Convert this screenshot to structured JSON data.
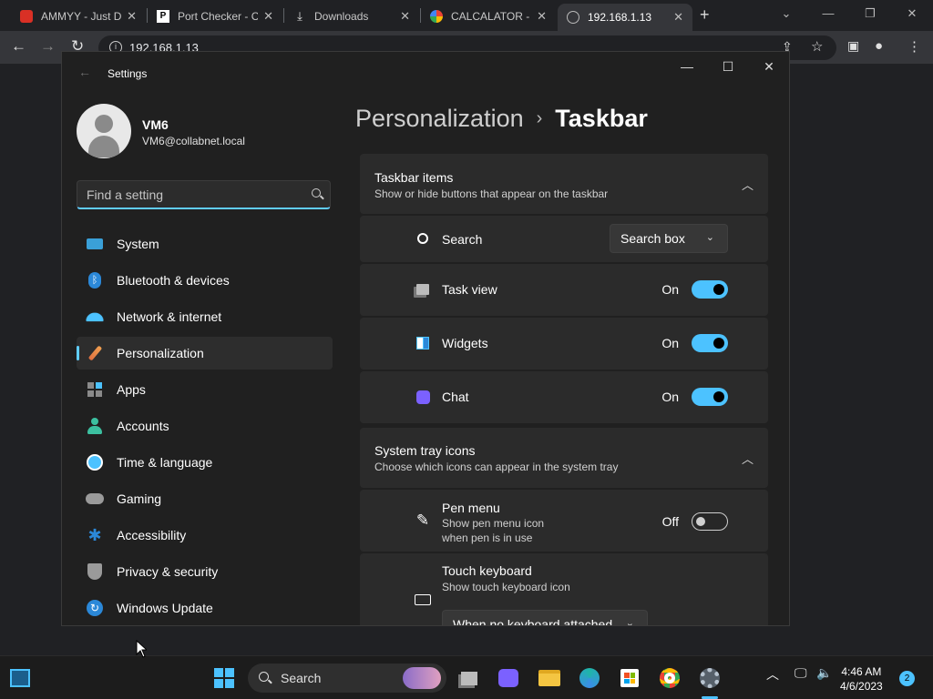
{
  "browser": {
    "tabs": [
      {
        "title": "AMMYY - Just D",
        "icon": "ammyy-icon",
        "color": "#d93025"
      },
      {
        "title": "Port Checker - C",
        "icon": "portchecker-icon",
        "color": "#ffffff"
      },
      {
        "title": "Downloads",
        "icon": "download-icon",
        "color": "#e0e0e0"
      },
      {
        "title": "CALCALATOR - ",
        "icon": "google-icon",
        "color": "#4285f4"
      },
      {
        "title": "192.168.1.13",
        "icon": "globe-icon",
        "color": "#9aa0a6"
      }
    ],
    "url": "192.168.1.13"
  },
  "settings": {
    "window_title": "Settings",
    "user": {
      "name": "VM6",
      "email": "VM6@collabnet.local"
    },
    "search_placeholder": "Find a setting",
    "nav": [
      {
        "label": "System",
        "icon": "system-icon",
        "color": "#3aa0d8"
      },
      {
        "label": "Bluetooth & devices",
        "icon": "bluetooth-icon",
        "color": "#2b88d8"
      },
      {
        "label": "Network & internet",
        "icon": "wifi-icon",
        "color": "#4cc2ff"
      },
      {
        "label": "Personalization",
        "icon": "brush-icon",
        "color": "#f0a050",
        "active": true
      },
      {
        "label": "Apps",
        "icon": "apps-icon",
        "color": "#8a8a8a"
      },
      {
        "label": "Accounts",
        "icon": "accounts-icon",
        "color": "#3cc0a0"
      },
      {
        "label": "Time & language",
        "icon": "clock-globe-icon",
        "color": "#4cc2ff"
      },
      {
        "label": "Gaming",
        "icon": "gamepad-icon",
        "color": "#9a9a9a"
      },
      {
        "label": "Accessibility",
        "icon": "accessibility-icon",
        "color": "#2b88d8"
      },
      {
        "label": "Privacy & security",
        "icon": "shield-icon",
        "color": "#9a9a9a"
      },
      {
        "label": "Windows Update",
        "icon": "update-icon",
        "color": "#2b88d8"
      }
    ],
    "breadcrumb": {
      "parent": "Personalization",
      "separator": "›",
      "current": "Taskbar"
    },
    "taskbar_items": {
      "title": "Taskbar items",
      "subtitle": "Show or hide buttons that appear on the taskbar",
      "search": {
        "label": "Search",
        "value": "Search box"
      },
      "task_view": {
        "label": "Task view",
        "state": "On"
      },
      "widgets": {
        "label": "Widgets",
        "state": "On"
      },
      "chat": {
        "label": "Chat",
        "state": "On"
      }
    },
    "system_tray_icons": {
      "title": "System tray icons",
      "subtitle": "Choose which icons can appear in the system tray",
      "pen_menu": {
        "label": "Pen menu",
        "sub1": "Show pen menu icon",
        "sub2": "when pen is in use",
        "state": "Off"
      },
      "touch_keyboard": {
        "label": "Touch keyboard",
        "sub": "Show touch keyboard icon",
        "value": "When no keyboard attached"
      }
    }
  },
  "taskbar": {
    "search_label": "Search",
    "time": "4:46 AM",
    "date": "4/6/2023",
    "notifications": "2"
  },
  "colors": {
    "accent": "#4cc2ff",
    "window_bg": "#202020",
    "card_bg": "#2b2b2b"
  }
}
